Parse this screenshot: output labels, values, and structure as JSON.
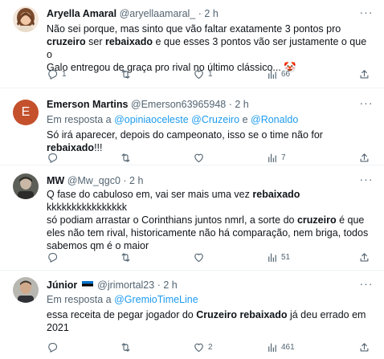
{
  "tweets": [
    {
      "name": "Aryella Amaral",
      "handle": "@aryellaamaral_",
      "time": "2 h",
      "lines": [
        [
          {
            "t": "Não sei porque, mas sinto que vão faltar exatamente 3 pontos pro"
          }
        ],
        [
          {
            "t": "cruzeiro",
            "b": true
          },
          {
            "t": " ser "
          },
          {
            "t": "rebaixado",
            "b": true
          },
          {
            "t": " e que esses 3 pontos vão ser justamente o que o"
          }
        ],
        [
          {
            "t": "Galo entregou de graça pro rival no último clássico... 🤡"
          }
        ]
      ],
      "counts": {
        "replies": "1",
        "retweets": "",
        "likes": "1",
        "views": "66"
      }
    },
    {
      "name": "Emerson Martins",
      "handle": "@Emerson63965948",
      "time": "2 h",
      "avatar_letter": "E",
      "reply_prefix": "Em resposta a",
      "reply_mentions": [
        "@opiniaoceleste",
        "@Cruzeiro",
        "@Ronaldo"
      ],
      "reply_joiner": "e",
      "lines": [
        [
          {
            "t": "Só irá aparecer, depois do campeonato, isso se o time não for "
          },
          {
            "t": "rebaixado",
            "b": true
          },
          {
            "t": "!!!"
          }
        ]
      ],
      "counts": {
        "replies": "",
        "retweets": "",
        "likes": "",
        "views": "7"
      }
    },
    {
      "name": "MW",
      "handle": "@Mw_qgc0",
      "time": "2 h",
      "lines": [
        [
          {
            "t": "Q fase do cabuloso em, vai ser mais uma vez "
          },
          {
            "t": "rebaixado",
            "b": true
          },
          {
            "t": " kkkkkkkkkkkkkkkk"
          }
        ],
        [
          {
            "t": "só podiam arrastar o Corinthians juntos nmrl, a sorte do "
          },
          {
            "t": "cruzeiro",
            "b": true
          },
          {
            "t": " é que"
          }
        ],
        [
          {
            "t": "eles não tem rival, historicamente não há comparação, nem briga, todos"
          }
        ],
        [
          {
            "t": "sabemos qm é o maior"
          }
        ]
      ],
      "counts": {
        "replies": "",
        "retweets": "",
        "likes": "",
        "views": "51"
      }
    },
    {
      "name": "Júnior",
      "handle": "@jrimortal23",
      "time": "2 h",
      "reply_prefix": "Em resposta a",
      "reply_mentions": [
        "@GremioTimeLine"
      ],
      "reply_joiner": "",
      "lines": [
        [
          {
            "t": "essa receita de pegar jogador do "
          },
          {
            "t": "Cruzeiro",
            "b": true
          },
          {
            "t": " "
          },
          {
            "t": "rebaixado",
            "b": true
          },
          {
            "t": " já deu errado em"
          }
        ],
        [
          {
            "t": "2021"
          }
        ]
      ],
      "counts": {
        "replies": "",
        "retweets": "",
        "likes": "2",
        "views": "461"
      }
    }
  ],
  "icons": {
    "more": "more-dots-icon",
    "reply": "reply-bubble-icon",
    "retweet": "retweet-icon",
    "like": "heart-icon",
    "views": "views-chart-icon",
    "share": "share-upload-icon",
    "flag": "estonia-flag-icon"
  },
  "colors": {
    "text": "#0f1419",
    "secondary": "#536471",
    "link": "#1d9bf0",
    "divider": "#eff3f4",
    "avatar_emerson": "#c4502c"
  }
}
